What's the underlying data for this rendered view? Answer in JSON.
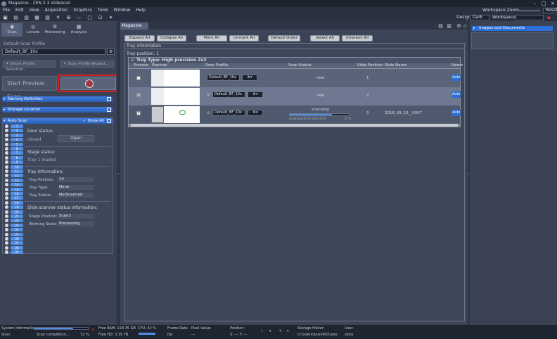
{
  "window": {
    "title": "Magazine - ZEN 2.3 slidescan"
  },
  "menu": [
    "File",
    "Edit",
    "View",
    "Acquisition",
    "Graphics",
    "Tools",
    "Window",
    "Help"
  ],
  "workspace_zoom": {
    "label": "Workspace Zoom",
    "reset": "Reset"
  },
  "design": {
    "label": "Design",
    "value": "Dark"
  },
  "workspace": {
    "label": "Workspace",
    "value": ""
  },
  "left_tabs": [
    {
      "label": "Scan",
      "icon": "camera-icon"
    },
    {
      "label": "Locate",
      "icon": "locate-icon"
    },
    {
      "label": "Processing",
      "icon": "processing-icon"
    },
    {
      "label": "Analysis",
      "icon": "analysis-icon"
    }
  ],
  "scan_profile": {
    "label": "Default Scan Profile",
    "value": "Default_BF_10x"
  },
  "profile_buttons": {
    "smart": "Smart Profile Selection...",
    "wizard": "Scan Profile Wizard..."
  },
  "preview_scan": {
    "label": "Start Preview Scan"
  },
  "sections": {
    "naming": "Naming Definition",
    "storage": "Storage Location",
    "auto_scan": "Auto Scan",
    "show_all": "Show All"
  },
  "door": {
    "label": "Door status:",
    "state_label": "closed",
    "button": "Open"
  },
  "stage": {
    "label": "Stage status:",
    "value": "Tray 1 loaded"
  },
  "tray_info": {
    "label": "Tray Information:",
    "position_label": "Tray Position:",
    "position": "14",
    "type_label": "Tray Type:",
    "type": "None",
    "status_label": "Tray Status:",
    "status": "NotScanned"
  },
  "scanner_info": {
    "label": "Slide scanner status information:",
    "stage_pos_label": "Stage Position:",
    "stage_pos": "Scan3",
    "working_label": "Working State:",
    "working": "Processing"
  },
  "tray_numbers": [
    "1",
    "2",
    "3",
    "4",
    "5",
    "6",
    "7",
    "8",
    "9",
    "10",
    "11",
    "12",
    "13",
    "14",
    "15",
    "16",
    "17",
    "18",
    "19",
    "20",
    "21",
    "22",
    "23",
    "24",
    "25",
    "26",
    "27",
    "28",
    "29"
  ],
  "magazine": {
    "tab": "Magazine",
    "buttons": [
      "Expand All",
      "Collapse All",
      "Mark All",
      "Unmark All",
      "Default Order",
      "Select All",
      "Unselect All"
    ],
    "tray_information": "Tray information",
    "tray_position_label": "Tray position:",
    "tray_position": "1",
    "tray_type_label": "Tray Type:",
    "tray_type": "High precision 2x3",
    "columns": [
      "Process",
      "Preview",
      "Scan Profile",
      "Scan Status",
      "Slide Position",
      "Slide Name",
      "Name"
    ],
    "rows": [
      {
        "checked": "",
        "profile": "Default_BF_10x",
        "status": "new",
        "position": "1",
        "name": "",
        "btn": "Auto"
      },
      {
        "checked": "",
        "profile": "Default_BF_10x",
        "status": "new",
        "position": "2",
        "name": "",
        "btn": "Auto"
      },
      {
        "checked": "✓",
        "profile": "Default_BF_10x",
        "status": "scanning",
        "position": "3",
        "name": "2018_09_10__0007",
        "btn": "Auto",
        "progress_text": "scanning (45 of 100) 10 %",
        "progress_pct": "72 %",
        "progress": 0.72
      }
    ]
  },
  "right_panel": {
    "title": "Images and Documents"
  },
  "statusbar": {
    "system_info": "System Information:",
    "scan": "Scan",
    "scan_completion": "Scan completion...",
    "scan_pct": "72 %",
    "scan_progress": 0.72,
    "free_ram": "Free RAM: 118.35 GB",
    "free_hd": "Free HD:  3.35 TB",
    "cpu": "CPU: 42 %",
    "frame_rate_label": "Frame Rate:",
    "frame_rate": "fps",
    "pixel_label": "Pixel Value:",
    "pixel": "---",
    "position_label": "Position:",
    "position": "X: --- Y: ---",
    "storage_label": "Storage Folder:",
    "storage": "D:\\Users\\zeiss\\Pictures",
    "user_label": "User:",
    "user": "zeiss"
  },
  "colors": {
    "accent": "#3f7de0",
    "highlight": "#d42020",
    "panel": "#3a4254"
  }
}
